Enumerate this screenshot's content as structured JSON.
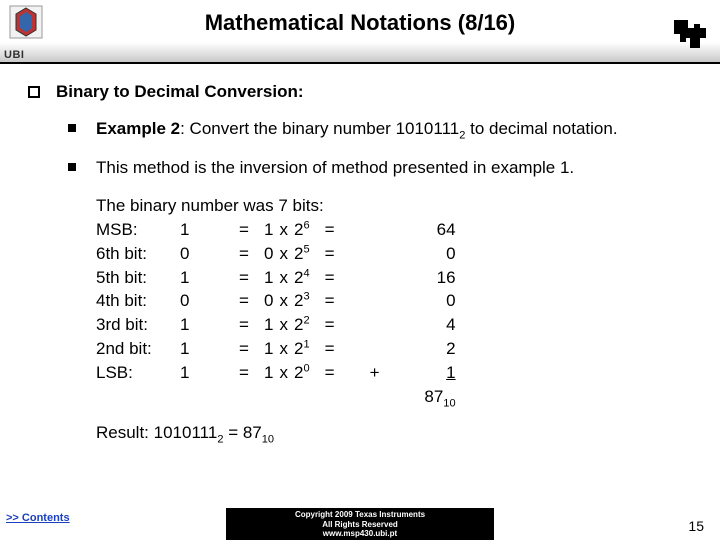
{
  "header": {
    "title": "Mathematical Notations (8/16)",
    "ubi_label": "UBI"
  },
  "bullets": {
    "heading": "Binary to Decimal Conversion:",
    "ex_label": "Example 2",
    "ex_rest": ": Convert the binary number ",
    "ex_num": "1010111",
    "ex_sub": "2",
    "ex_tail": "  to decimal notation.",
    "method": "This method is the inversion of method presented in example 1."
  },
  "work": {
    "intro": "The binary number was 7 bits:",
    "rows": [
      {
        "label": "MSB:",
        "bit": "1",
        "coef": "1",
        "base": "2",
        "exp": "6",
        "value": "64"
      },
      {
        "label": "6th bit:",
        "bit": "0",
        "coef": "0",
        "base": "2",
        "exp": "5",
        "value": "0"
      },
      {
        "label": "5th bit:",
        "bit": "1",
        "coef": "1",
        "base": "2",
        "exp": "4",
        "value": "16"
      },
      {
        "label": "4th bit:",
        "bit": "0",
        "coef": "0",
        "base": "2",
        "exp": "3",
        "value": "0"
      },
      {
        "label": "3rd bit:",
        "bit": "1",
        "coef": "1",
        "base": "2",
        "exp": "2",
        "value": "4"
      },
      {
        "label": "2nd bit:",
        "bit": "1",
        "coef": "1",
        "base": "2",
        "exp": "1",
        "value": "2"
      },
      {
        "label": "LSB:",
        "bit": "1",
        "coef": "1",
        "base": "2",
        "exp": "0",
        "value": "1"
      }
    ],
    "plus": "+",
    "sum": "87",
    "sum_sub": "10",
    "result_label": "Result: ",
    "result_bin": "1010111",
    "result_bin_sub": "2",
    "result_eq": " = ",
    "result_dec": "87",
    "result_dec_sub": "10"
  },
  "footer": {
    "contents": ">> Contents",
    "copy1": "Copyright 2009 Texas Instruments",
    "copy2": "All Rights Reserved",
    "copy3": "www.msp430.ubi.pt",
    "page": "15"
  }
}
